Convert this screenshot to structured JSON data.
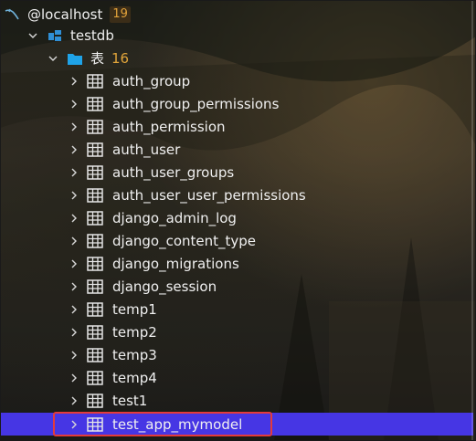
{
  "connection": {
    "label": "@localhost",
    "count": "19"
  },
  "database": {
    "label": "testdb"
  },
  "tables_folder": {
    "label": "表",
    "count": "16"
  },
  "tables": [
    {
      "label": "auth_group"
    },
    {
      "label": "auth_group_permissions"
    },
    {
      "label": "auth_permission"
    },
    {
      "label": "auth_user"
    },
    {
      "label": "auth_user_groups"
    },
    {
      "label": "auth_user_user_permissions"
    },
    {
      "label": "django_admin_log"
    },
    {
      "label": "django_content_type"
    },
    {
      "label": "django_migrations"
    },
    {
      "label": "django_session"
    },
    {
      "label": "temp1"
    },
    {
      "label": "temp2"
    },
    {
      "label": "temp3"
    },
    {
      "label": "temp4"
    },
    {
      "label": "test1"
    },
    {
      "label": "test_app_mymodel"
    }
  ],
  "icons": {
    "connection": "dolphin-icon",
    "database": "database-schema-icon",
    "folder": "folder-icon",
    "table": "table-icon",
    "expanded": "chevron-down-icon",
    "collapsed": "chevron-right-icon"
  },
  "colors": {
    "selection": "#4636e4",
    "highlight_border": "#e33b3b",
    "folder": "#1fa3e8",
    "count": "#e0a43a"
  }
}
